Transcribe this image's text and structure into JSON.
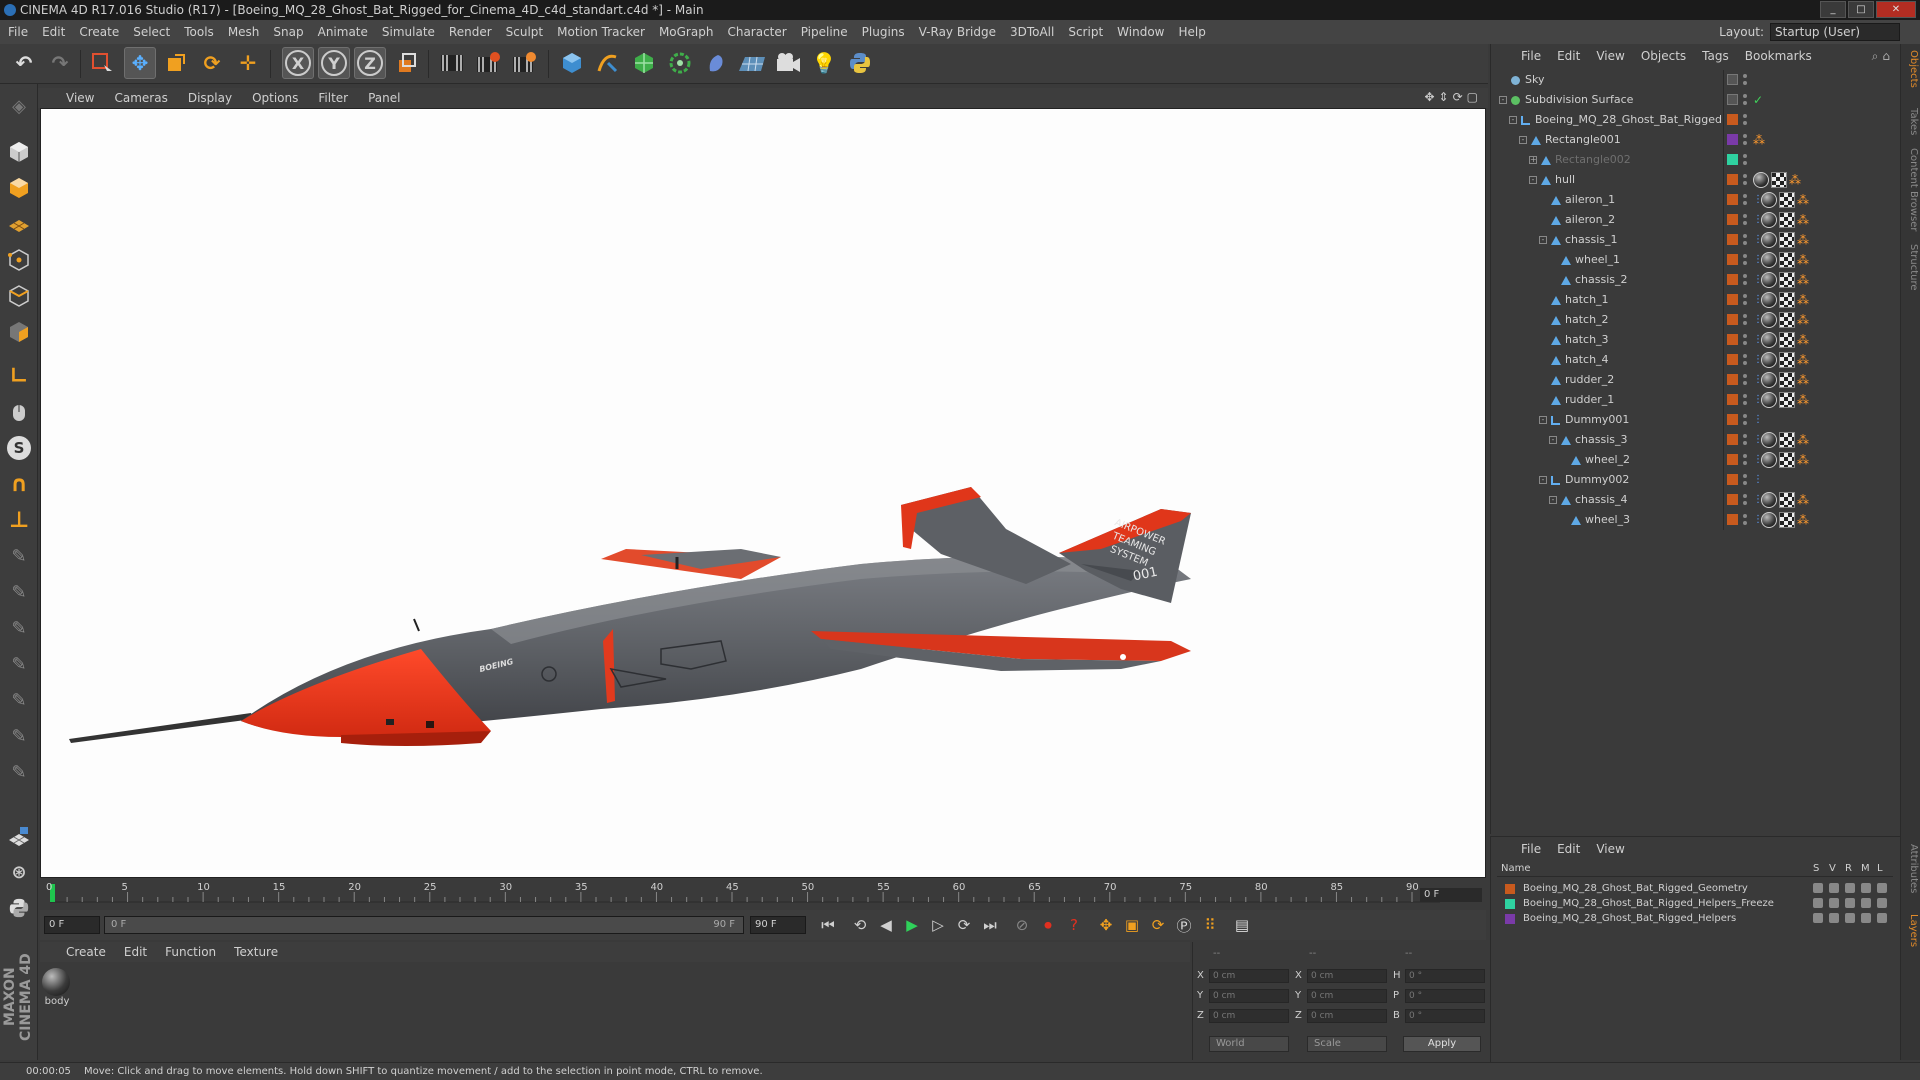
{
  "window": {
    "title": "CINEMA 4D R17.016 Studio (R17) - [Boeing_MQ_28_Ghost_Bat_Rigged_for_Cinema_4D_c4d_standart.c4d *] - Main"
  },
  "menubar": {
    "items": [
      "File",
      "Edit",
      "Create",
      "Select",
      "Tools",
      "Mesh",
      "Snap",
      "Animate",
      "Simulate",
      "Render",
      "Sculpt",
      "Motion Tracker",
      "MoGraph",
      "Character",
      "Pipeline",
      "Plugins",
      "V-Ray Bridge",
      "3DToAll",
      "Script",
      "Window",
      "Help"
    ],
    "layout_label": "Layout:",
    "layout_value": "Startup (User)"
  },
  "toolbar": {
    "axis_x": "X",
    "axis_y": "Y",
    "axis_z": "Z",
    "icons": [
      "undo-icon",
      "redo-icon",
      "live-select-icon",
      "move-icon",
      "scale-icon",
      "rotate-icon",
      "recent-tool-icon",
      "x-axis-lock",
      "y-axis-lock",
      "z-axis-lock",
      "coordinate-system-icon",
      "render-view-icon",
      "render-picture-viewer-icon",
      "edit-render-settings-icon",
      "cube-icon",
      "pen-spline-icon",
      "subdivision-icon",
      "array-icon",
      "deformer-icon",
      "floor-icon",
      "camera-icon",
      "light-icon",
      "python-icon"
    ]
  },
  "viewport": {
    "menu": [
      "View",
      "Cameras",
      "Display",
      "Options",
      "Filter",
      "Panel"
    ],
    "drone_tail_text_1": "AIRPOWER",
    "drone_tail_text_2": "TEAMING",
    "drone_tail_text_3": "SYSTEM",
    "drone_tail_number": "001",
    "drone_brand": "BOEING"
  },
  "timeline": {
    "ticks": [
      "0",
      "5",
      "10",
      "15",
      "20",
      "25",
      "30",
      "35",
      "40",
      "45",
      "50",
      "55",
      "60",
      "65",
      "70",
      "75",
      "80",
      "85",
      "90"
    ],
    "current_frame": "0 F"
  },
  "transport": {
    "start_frame": "0 F",
    "range_start": "0 F",
    "range_end": "90 F",
    "end_frame": "90 F"
  },
  "materials": {
    "menu": [
      "Create",
      "Edit",
      "Function",
      "Texture"
    ],
    "items": [
      {
        "name": "body"
      }
    ]
  },
  "coords": {
    "header_1": "--",
    "header_2": "--",
    "header_3": "--",
    "rows": [
      {
        "a": "X",
        "av": "0 cm",
        "b": "X",
        "bv": "0 cm",
        "c": "H",
        "cv": "0 °"
      },
      {
        "a": "Y",
        "av": "0 cm",
        "b": "Y",
        "bv": "0 cm",
        "c": "P",
        "cv": "0 °"
      },
      {
        "a": "Z",
        "av": "0 cm",
        "b": "Z",
        "bv": "0 cm",
        "c": "B",
        "cv": "0 °"
      }
    ],
    "space": "World",
    "mode": "Scale",
    "apply": "Apply"
  },
  "status": {
    "time": "00:00:05",
    "message": "Move: Click and drag to move elements. Hold down SHIFT to quantize movement / add to the selection in point mode, CTRL to remove."
  },
  "objects": {
    "menu": [
      "File",
      "Edit",
      "View",
      "Objects",
      "Tags",
      "Bookmarks"
    ],
    "rows": [
      {
        "name": "Sky",
        "indent": 0,
        "icon": "sphere",
        "expand": "",
        "layer": "",
        "tags": [],
        "dim": false
      },
      {
        "name": "Subdivision Surface",
        "indent": 0,
        "icon": "green",
        "expand": "-",
        "layer": "",
        "tags": [
          "check-mark"
        ],
        "dim": false
      },
      {
        "name": "Boeing_MQ_28_Ghost_Bat_Rigged",
        "indent": 1,
        "icon": "null",
        "expand": "-",
        "layer": "#c85a1e",
        "tags": [],
        "dim": false
      },
      {
        "name": "Rectangle001",
        "indent": 2,
        "icon": "poly",
        "expand": "-",
        "layer": "#7a3aa8",
        "tags": [
          "chain"
        ],
        "dim": false
      },
      {
        "name": "Rectangle002",
        "indent": 3,
        "icon": "poly",
        "expand": "+",
        "layer": "#2fd1a0",
        "tags": [],
        "dim": true
      },
      {
        "name": "hull",
        "indent": 3,
        "icon": "poly",
        "expand": "-",
        "layer": "#c85a1e",
        "tags": [
          "ball",
          "check",
          "chain"
        ],
        "dim": false
      },
      {
        "name": "aileron_1",
        "indent": 4,
        "icon": "poly",
        "expand": "",
        "layer": "#c85a1e",
        "tags": [
          "weight",
          "ball",
          "check",
          "chain"
        ],
        "dim": false
      },
      {
        "name": "aileron_2",
        "indent": 4,
        "icon": "poly",
        "expand": "",
        "layer": "#c85a1e",
        "tags": [
          "weight",
          "ball",
          "check",
          "chain"
        ],
        "dim": false
      },
      {
        "name": "chassis_1",
        "indent": 4,
        "icon": "poly",
        "expand": "-",
        "layer": "#c85a1e",
        "tags": [
          "weight",
          "ball",
          "check",
          "chain"
        ],
        "dim": false
      },
      {
        "name": "wheel_1",
        "indent": 5,
        "icon": "poly",
        "expand": "",
        "layer": "#c85a1e",
        "tags": [
          "weight",
          "ball",
          "check",
          "chain"
        ],
        "dim": false
      },
      {
        "name": "chassis_2",
        "indent": 5,
        "icon": "poly",
        "expand": "",
        "layer": "#c85a1e",
        "tags": [
          "weight",
          "ball",
          "check",
          "chain"
        ],
        "dim": false
      },
      {
        "name": "hatch_1",
        "indent": 4,
        "icon": "poly",
        "expand": "",
        "layer": "#c85a1e",
        "tags": [
          "weight",
          "ball",
          "check",
          "chain"
        ],
        "dim": false
      },
      {
        "name": "hatch_2",
        "indent": 4,
        "icon": "poly",
        "expand": "",
        "layer": "#c85a1e",
        "tags": [
          "weight",
          "ball",
          "check",
          "chain"
        ],
        "dim": false
      },
      {
        "name": "hatch_3",
        "indent": 4,
        "icon": "poly",
        "expand": "",
        "layer": "#c85a1e",
        "tags": [
          "weight",
          "ball",
          "check",
          "chain"
        ],
        "dim": false
      },
      {
        "name": "hatch_4",
        "indent": 4,
        "icon": "poly",
        "expand": "",
        "layer": "#c85a1e",
        "tags": [
          "weight",
          "ball",
          "check",
          "chain"
        ],
        "dim": false
      },
      {
        "name": "rudder_2",
        "indent": 4,
        "icon": "poly",
        "expand": "",
        "layer": "#c85a1e",
        "tags": [
          "weight",
          "ball",
          "check",
          "chain"
        ],
        "dim": false
      },
      {
        "name": "rudder_1",
        "indent": 4,
        "icon": "poly",
        "expand": "",
        "layer": "#c85a1e",
        "tags": [
          "weight",
          "ball",
          "check",
          "chain"
        ],
        "dim": false
      },
      {
        "name": "Dummy001",
        "indent": 4,
        "icon": "null",
        "expand": "-",
        "layer": "#c85a1e",
        "tags": [
          "weight"
        ],
        "dim": false
      },
      {
        "name": "chassis_3",
        "indent": 5,
        "icon": "poly",
        "expand": "-",
        "layer": "#c85a1e",
        "tags": [
          "weight",
          "ball",
          "check",
          "chain"
        ],
        "dim": false
      },
      {
        "name": "wheel_2",
        "indent": 6,
        "icon": "poly",
        "expand": "",
        "layer": "#c85a1e",
        "tags": [
          "weight",
          "ball",
          "check",
          "chain"
        ],
        "dim": false
      },
      {
        "name": "Dummy002",
        "indent": 4,
        "icon": "null",
        "expand": "-",
        "layer": "#c85a1e",
        "tags": [
          "weight"
        ],
        "dim": false
      },
      {
        "name": "chassis_4",
        "indent": 5,
        "icon": "poly",
        "expand": "-",
        "layer": "#c85a1e",
        "tags": [
          "weight",
          "ball",
          "check",
          "chain"
        ],
        "dim": false
      },
      {
        "name": "wheel_3",
        "indent": 6,
        "icon": "poly",
        "expand": "",
        "layer": "#c85a1e",
        "tags": [
          "weight",
          "ball",
          "check",
          "chain"
        ],
        "dim": false
      }
    ]
  },
  "layers": {
    "menu": [
      "File",
      "Edit",
      "View"
    ],
    "header_name": "Name",
    "header_flags": [
      "S",
      "V",
      "R",
      "M",
      "L"
    ],
    "rows": [
      {
        "name": "Boeing_MQ_28_Ghost_Bat_Rigged_Geometry",
        "color": "#c85a1e"
      },
      {
        "name": "Boeing_MQ_28_Ghost_Bat_Rigged_Helpers_Freeze",
        "color": "#2fd1a0"
      },
      {
        "name": "Boeing_MQ_28_Ghost_Bat_Rigged_Helpers",
        "color": "#7a3aa8"
      }
    ]
  },
  "sidetabs": [
    "Objects",
    "Takes",
    "Content Browser",
    "Structure",
    "Attributes",
    "Layers"
  ],
  "maxon_logo": "MAXON CINEMA 4D"
}
